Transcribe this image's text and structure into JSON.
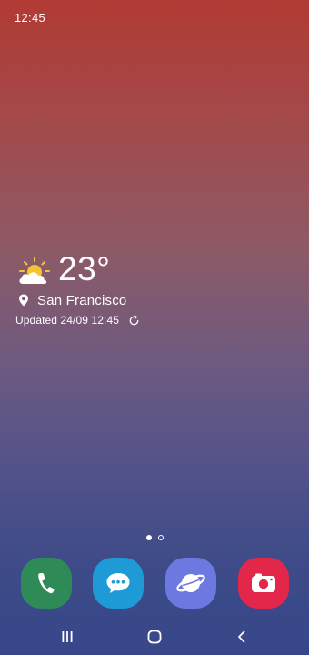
{
  "status_bar": {
    "time": "12:45"
  },
  "weather": {
    "icon": "partly-cloudy-icon",
    "temperature": "23°",
    "location": "San Francisco",
    "updated": "Updated 24/09 12:45"
  },
  "home": {
    "pages": 2,
    "current_page": 1
  },
  "dock": {
    "apps": [
      {
        "icon": "phone-icon",
        "color": "#2e8b57"
      },
      {
        "icon": "messages-icon",
        "color": "#1e9ad6"
      },
      {
        "icon": "internet-icon",
        "color": "#6d79e0"
      },
      {
        "icon": "camera-icon",
        "color": "#e3274a"
      }
    ]
  },
  "nav_bar": {
    "buttons": [
      "recents-icon",
      "home-icon",
      "back-icon"
    ]
  }
}
